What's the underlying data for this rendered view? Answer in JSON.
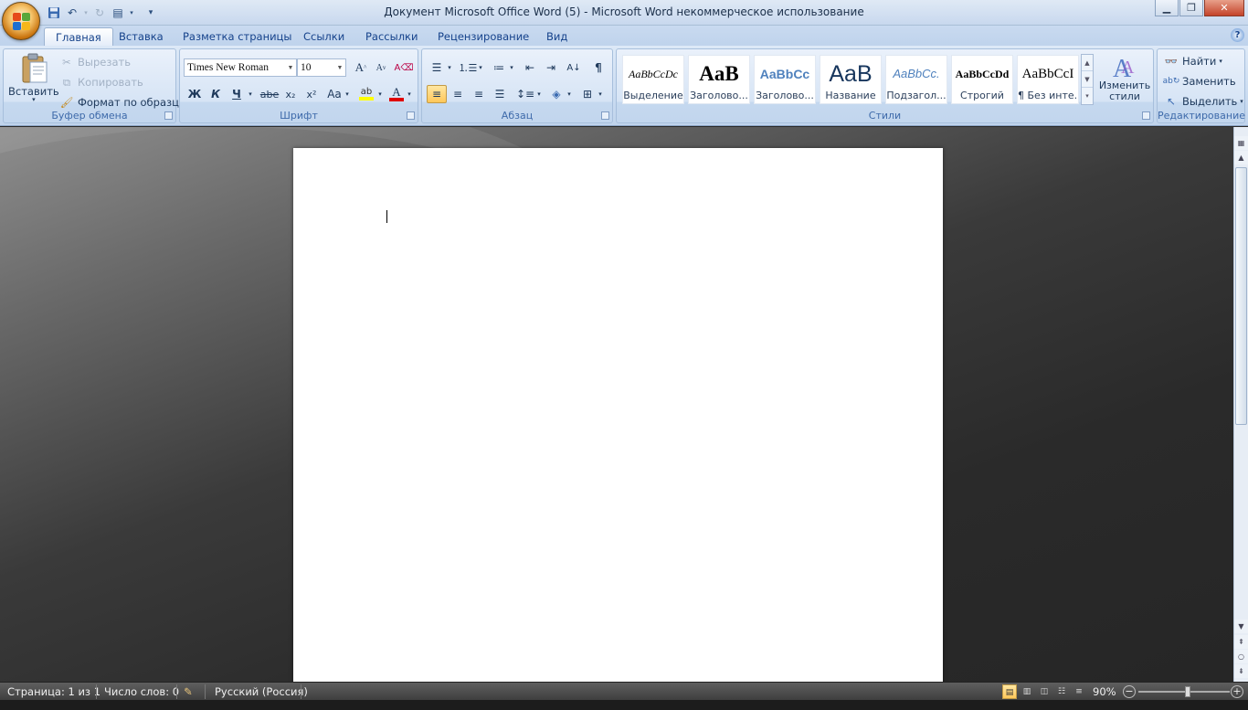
{
  "window": {
    "title": "Документ Microsoft Office Word (5)  -  Microsoft Word некоммерческое использование",
    "minimize_icon": "minimize-icon",
    "maximize_icon": "restore-icon",
    "close_icon": "close-icon"
  },
  "tabs": [
    "Главная",
    "Вставка",
    "Разметка страницы",
    "Ссылки",
    "Рассылки",
    "Рецензирование",
    "Вид"
  ],
  "clipboard": {
    "label": "Буфер обмена",
    "paste": "Вставить",
    "cut": "Вырезать",
    "copy": "Копировать",
    "format_painter": "Формат по образцу"
  },
  "font": {
    "label": "Шрифт",
    "name": "Times New Roman",
    "size": "10",
    "bold": "Ж",
    "italic": "К",
    "underline": "Ч",
    "strike": "abe",
    "subscript": "x₂",
    "superscript": "x²",
    "case": "Aa",
    "grow": "A",
    "shrink": "A"
  },
  "paragraph": {
    "label": "Абзац",
    "pilcrow": "¶"
  },
  "styles": {
    "label": "Стили",
    "items": [
      {
        "preview": "AaBbCcDc",
        "name": "Выделение"
      },
      {
        "preview": "AaB",
        "name": "Заголово..."
      },
      {
        "preview": "AaBbCc",
        "name": "Заголово..."
      },
      {
        "preview": "AaB",
        "name": "Название"
      },
      {
        "preview": "AaBbCc.",
        "name": "Подзагол..."
      },
      {
        "preview": "AaBbCcDd",
        "name": "Строгий"
      },
      {
        "preview": "AaBbCcI",
        "name": "¶ Без инте..."
      }
    ],
    "change_styles": "Изменить стили"
  },
  "editing": {
    "label": "Редактирование",
    "find": "Найти",
    "replace": "Заменить",
    "select": "Выделить"
  },
  "status": {
    "page": "Страница: 1 из 1",
    "words": "Число слов: 0",
    "language": "Русский (Россия)",
    "zoom": "90%",
    "zoom_level": 0.54
  }
}
